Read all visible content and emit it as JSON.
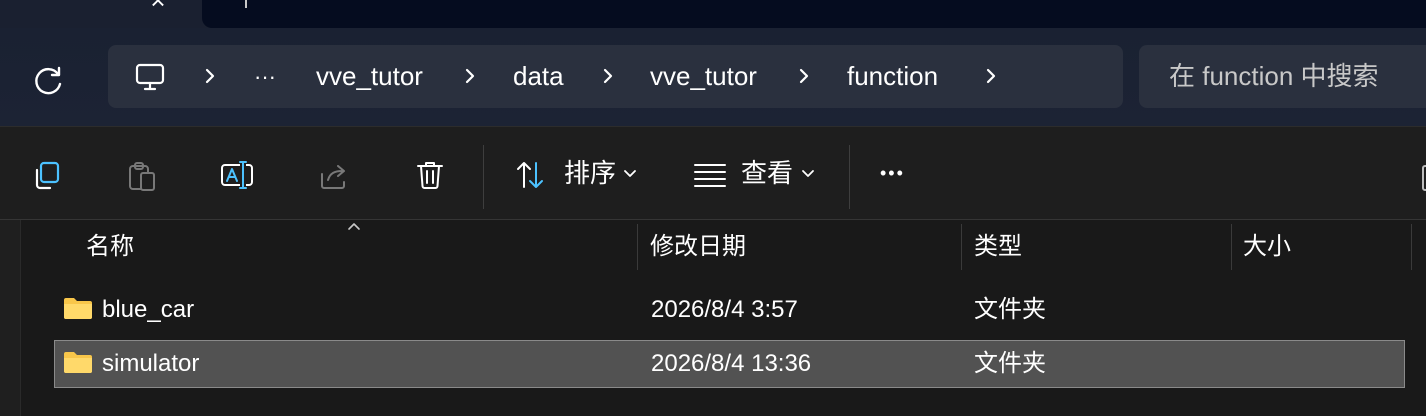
{
  "tabstrip": {
    "close_icon": "close-icon"
  },
  "address_bar": {
    "breadcrumb": [
      "vve_tutor",
      "data",
      "vve_tutor",
      "function"
    ],
    "overflow_label": "···",
    "search_placeholder": "在 function 中搜索"
  },
  "toolbar": {
    "sort_label": "排序",
    "view_label": "查看",
    "more_label": "•••"
  },
  "file_list": {
    "columns": {
      "name": "名称",
      "modified": "修改日期",
      "type": "类型",
      "size": "大小"
    },
    "rows": [
      {
        "name": "blue_car",
        "modified": "2026/8/4 3:57",
        "type": "文件夹",
        "size": "",
        "selected": false
      },
      {
        "name": "simulator",
        "modified": "2026/8/4 13:36",
        "type": "文件夹",
        "size": "",
        "selected": true
      }
    ]
  },
  "colors": {
    "folder": "#f8c64a",
    "accent": "#4cc2ff",
    "selection": "#525252"
  }
}
